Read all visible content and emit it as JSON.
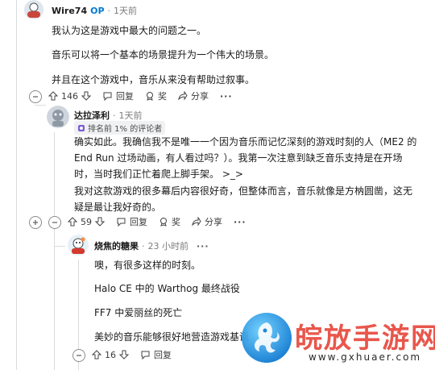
{
  "comment1": {
    "username": "Wire74",
    "op_badge": "OP",
    "dot": "·",
    "time": "1天前",
    "paragraphs": [
      "我认为这是游戏中最大的问题之一。",
      "音乐可以将一个基本的场景提升为一个伟大的场景。",
      "并且在这个游戏中，音乐从来没有帮助过叙事。"
    ],
    "collapse_symbol": "⊖",
    "score": "146",
    "reply_label": "回复",
    "award_label": "奖",
    "share_label": "分享",
    "more_label": "···"
  },
  "comment2": {
    "username": "达拉泽利",
    "dot": "·",
    "time": "1天前",
    "flair": "排名前 1% 的评论者",
    "paragraphs": [
      "确实如此。我确信我不是唯一一个因为音乐而记忆深刻的游戏时刻的人（ME2 的 End Run 过场动画，有人看过吗？）。我第一次注意到缺乏音乐支持是在开场时，当时我们正忙着爬上脚手架。 >_>",
      "我对这款游戏的很多幕后内容很好奇，但整体而言，音乐就像是方枘圆凿，这无疑是最让我好奇的。"
    ],
    "collapse_symbol": "⊖",
    "score": "59",
    "reply_label": "回复",
    "award_label": "奖",
    "share_label": "分享",
    "more_label": "···"
  },
  "comment3": {
    "username": "烧焦的糖果",
    "dot": "·",
    "time": "23 小时前",
    "more_label": "···",
    "paragraphs": [
      "噢，有很多这样的时刻。",
      "Halo CE 中的 Warthog 最终战役",
      "FF7 中爱丽丝的死亡",
      "美妙的音乐能够很好地营造游戏基调"
    ],
    "collapse_symbol": "⊖",
    "score": "16",
    "reply_label": "回复"
  },
  "watermark": {
    "text": "皖放手游网",
    "url": "www.gxhuaer.com"
  },
  "icons": {
    "upvote": "upvote-arrow-icon",
    "downvote": "downvote-arrow-icon",
    "reply": "speech-bubble-icon",
    "award": "award-ribbon-icon",
    "share": "share-arrow-icon",
    "more": "ellipsis-icon",
    "collapse": "collapse-minus-icon",
    "expand": "expand-plus-icon",
    "flair": "flair-badge-icon"
  },
  "colors": {
    "op": "#0079d3",
    "thread_line": "#d9dcdf",
    "watermark_text": "#e9564b",
    "watermark_logo": "#1681d6"
  }
}
